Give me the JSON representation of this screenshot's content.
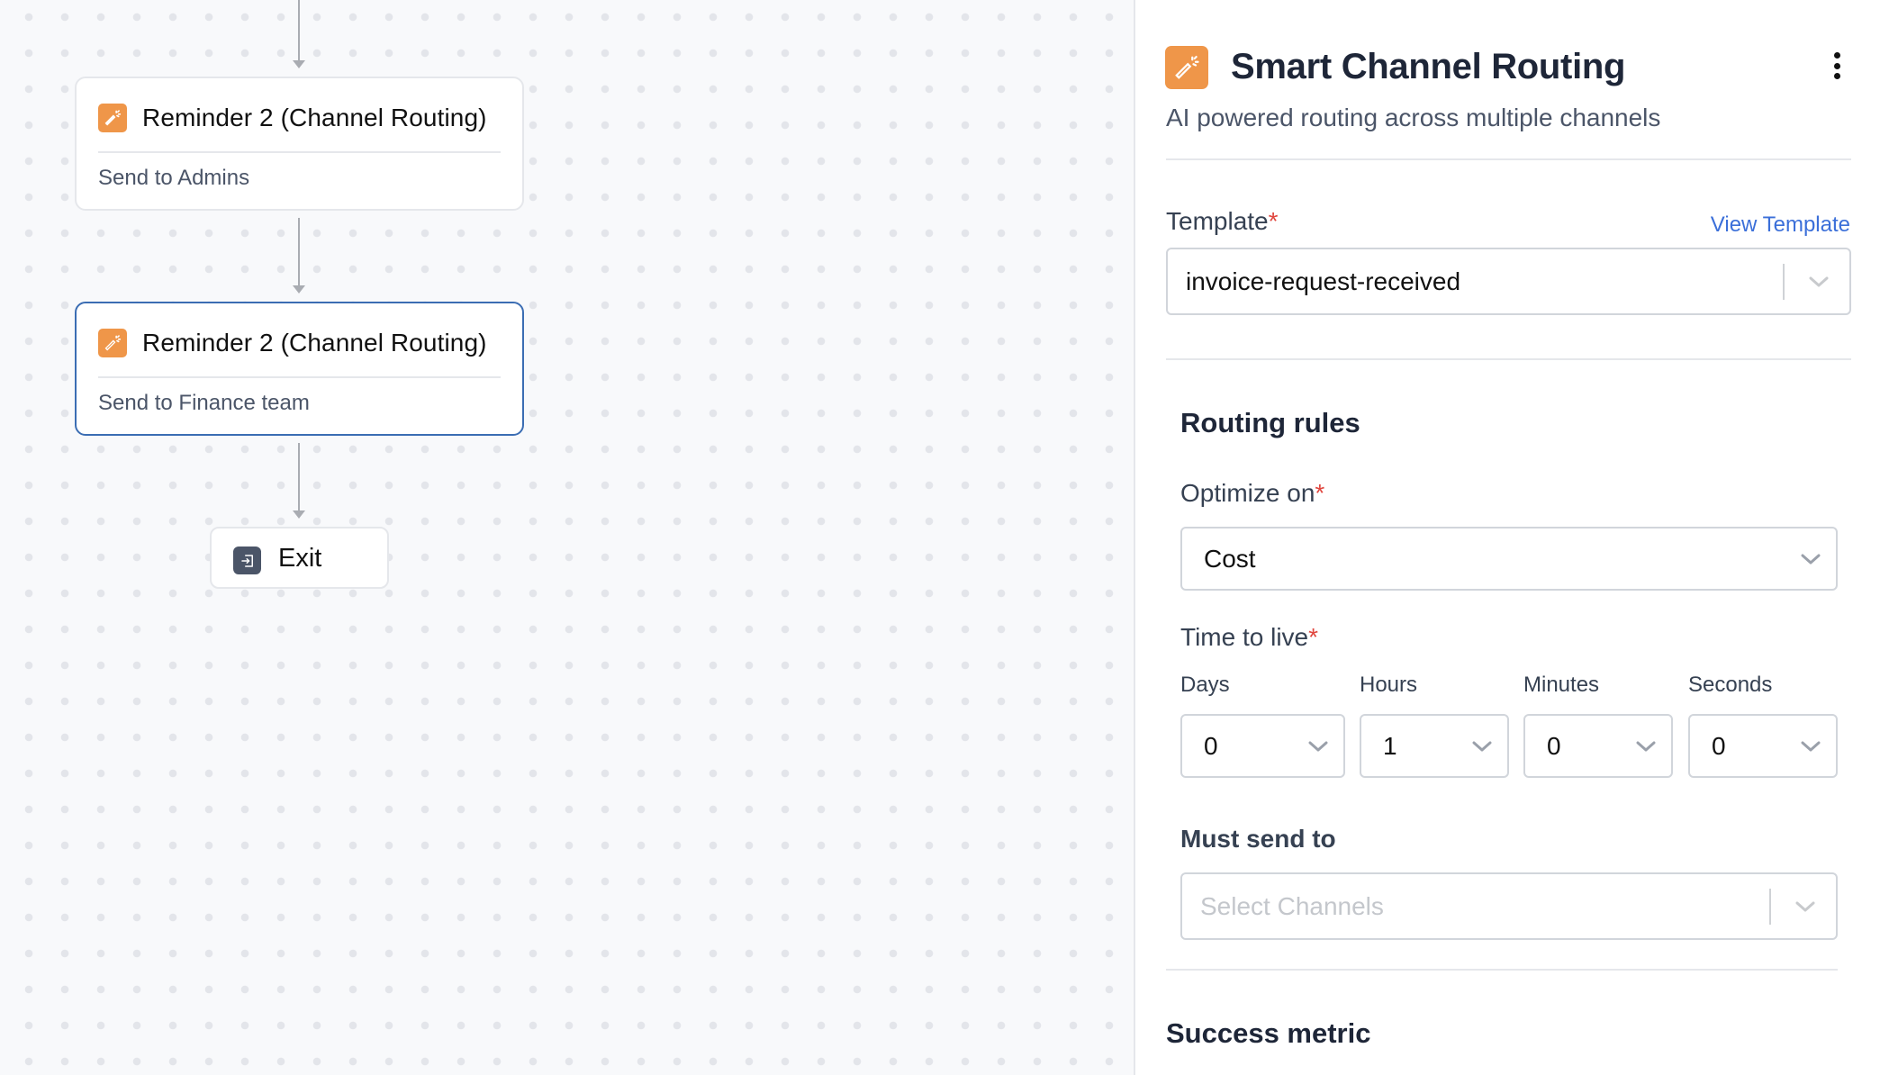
{
  "canvas": {
    "nodes": [
      {
        "title": "Reminder 2 (Channel Routing)",
        "subtitle": "Send to Admins",
        "icon": "magic-wand-icon",
        "selected": false
      },
      {
        "title": "Reminder 2 (Channel Routing)",
        "subtitle": "Send to Finance team",
        "icon": "magic-wand-icon",
        "selected": true
      }
    ],
    "exit": {
      "label": "Exit",
      "icon": "exit-icon"
    }
  },
  "panel": {
    "icon": "magic-wand-icon",
    "title": "Smart Channel Routing",
    "subtitle": "AI powered routing across multiple channels",
    "menu_icon": "more-vertical-icon",
    "template": {
      "label": "Template",
      "required_mark": "*",
      "link": "View Template",
      "value": "invoice-request-received"
    },
    "routing_rules": {
      "title": "Routing rules",
      "optimize_on": {
        "label": "Optimize on",
        "required_mark": "*",
        "value": "Cost"
      },
      "time_to_live": {
        "label": "Time to live",
        "required_mark": "*",
        "fields": [
          {
            "label": "Days",
            "value": "0"
          },
          {
            "label": "Hours",
            "value": "1"
          },
          {
            "label": "Minutes",
            "value": "0"
          },
          {
            "label": "Seconds",
            "value": "0"
          }
        ]
      },
      "must_send_to": {
        "label": "Must send to",
        "placeholder": "Select Channels"
      }
    },
    "success_metric": {
      "title": "Success metric"
    }
  },
  "colors": {
    "accent_orange": "#ef9649",
    "selected_border": "#3b6db3",
    "link_blue": "#3b6fd9",
    "required_red": "#e0463e"
  }
}
